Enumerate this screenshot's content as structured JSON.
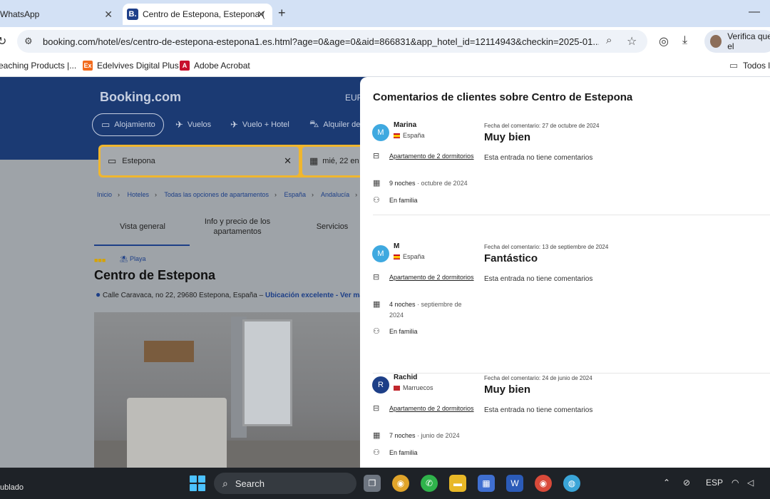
{
  "browser": {
    "tabs": [
      {
        "label": "WhatsApp",
        "active": false
      },
      {
        "label": "Centro de Estepona, Estepona (",
        "active": true,
        "favicon": "B."
      }
    ],
    "url": "booking.com/hotel/es/centro-de-estepona-estepona1.es.html?age=0&age=0&aid=866831&app_hotel_id=12114943&checkin=2025-01...",
    "profile_label": "Verifica que el",
    "bookmarks": [
      {
        "label": "eaching Products |...",
        "icon": "page-icon"
      },
      {
        "label": "Edelvives Digital Plus",
        "icon": "edelvives-icon",
        "color": "#f26b1d"
      },
      {
        "label": "Adobe Acrobat",
        "icon": "acrobat-icon",
        "color": "#c8102e"
      },
      {
        "label": "Todos lo",
        "icon": "folder-icon"
      }
    ]
  },
  "site": {
    "logo": "Booking.com",
    "currency": "EUR",
    "nav": [
      {
        "label": "Alojamiento",
        "icon": "bed-icon"
      },
      {
        "label": "Vuelos",
        "icon": "plane-icon"
      },
      {
        "label": "Vuelo + Hotel",
        "icon": "plane-hotel-icon"
      },
      {
        "label": "Alquiler de",
        "icon": "car-icon"
      }
    ],
    "search": {
      "destination": "Estepona",
      "date": "mié, 22 en"
    },
    "breadcrumbs": [
      "Inicio",
      "Hoteles",
      "Todas las opciones de apartamentos",
      "España",
      "Andalucía"
    ],
    "page_tabs": [
      "Vista general",
      "Info y precio de los apartamentos",
      "Servicios"
    ],
    "playa_label": "Playa",
    "hotel_title": "Centro de Estepona",
    "address": "Calle Caravaca, no 22, 29680 Estepona, España –",
    "address_link": "Ubicación excelente - Ver ma"
  },
  "reviews_panel": {
    "title": "Comentarios de clientes sobre Centro de Estepona",
    "reviews": [
      {
        "initial": "M",
        "avatar_color": "#3fa9e0",
        "name": "Marina",
        "country": "España",
        "flag": "spain",
        "room": "Apartamento de 2 dormitorios",
        "nights": "9 noches",
        "stay_month": "octubre de 2024",
        "traveler_type": "En familia",
        "date": "Fecha del comentario: 27 de octubre de 2024",
        "score_label": "Muy bien",
        "comment": "Esta entrada no tiene comentarios"
      },
      {
        "initial": "M",
        "avatar_color": "#3fa9e0",
        "name": "M",
        "country": "España",
        "flag": "spain",
        "room": "Apartamento de 2 dormitorios",
        "nights": "4 noches",
        "stay_month": "septiembre de 2024",
        "traveler_type": "En familia",
        "date": "Fecha del comentario: 13 de septiembre de 2024",
        "score_label": "Fantástico",
        "comment": "Esta entrada no tiene comentarios"
      },
      {
        "initial": "R",
        "avatar_color": "#1d3f87",
        "name": "Rachid",
        "country": "Marruecos",
        "flag": "morocco",
        "room": "Apartamento de 2 dormitorios",
        "nights": "7 noches",
        "stay_month": "junio de 2024",
        "traveler_type": "En familia",
        "date": "Fecha del comentario: 24 de junio de 2024",
        "score_label": "Muy bien",
        "comment": "Esta entrada no tiene comentarios"
      }
    ]
  },
  "taskbar": {
    "left_text": "ublado",
    "search_label": "Search",
    "language": "ESP"
  }
}
